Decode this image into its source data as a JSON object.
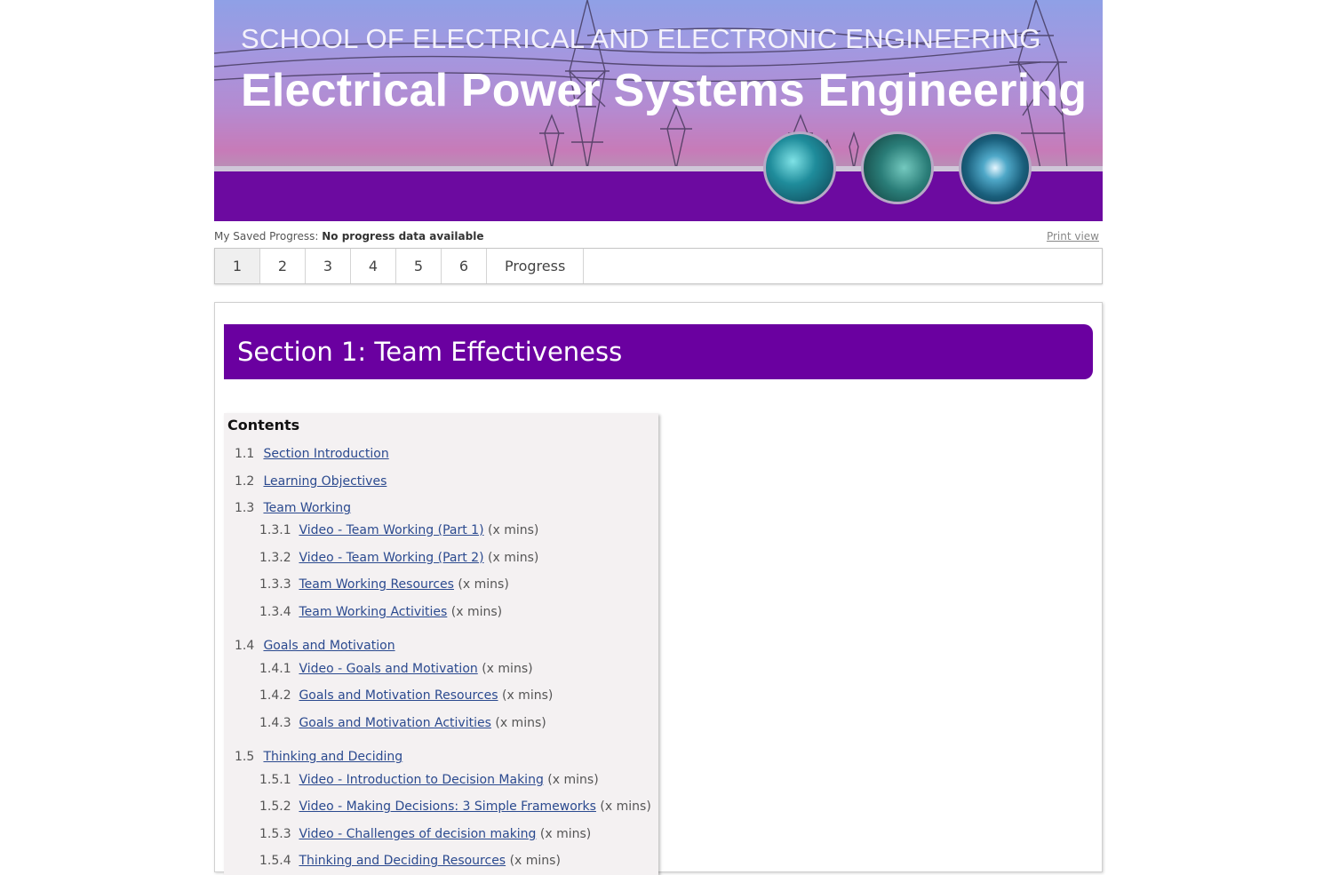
{
  "banner": {
    "school": "SCHOOL OF ELECTRICAL AND ELECTRONIC ENGINEERING",
    "title": "Electrical Power Systems Engineering"
  },
  "progress": {
    "label": "My Saved Progress:",
    "value": "No progress data available",
    "print_view": "Print view"
  },
  "tabs": [
    "1",
    "2",
    "3",
    "4",
    "5",
    "6",
    "Progress"
  ],
  "section": {
    "heading": "Section 1: Team Effectiveness"
  },
  "toc": {
    "title": "Contents",
    "items": [
      {
        "num": "1.1",
        "label": "Section Introduction",
        "dur": ""
      },
      {
        "num": "1.2",
        "label": "Learning Objectives",
        "dur": ""
      },
      {
        "num": "1.3",
        "label": "Team Working",
        "dur": ""
      },
      {
        "num": "1.3.1",
        "label": "Video - Team Working (Part 1)",
        "dur": "(x mins)"
      },
      {
        "num": "1.3.2",
        "label": "Video - Team Working (Part 2)",
        "dur": "(x mins)"
      },
      {
        "num": "1.3.3",
        "label": "Team Working Resources",
        "dur": "(x mins)"
      },
      {
        "num": "1.3.4",
        "label": "Team Working Activities",
        "dur": "(x mins)"
      },
      {
        "num": "1.4",
        "label": "Goals and Motivation",
        "dur": ""
      },
      {
        "num": "1.4.1",
        "label": "Video - Goals and Motivation",
        "dur": "(x mins)"
      },
      {
        "num": "1.4.2",
        "label": "Goals and Motivation Resources",
        "dur": "(x mins)"
      },
      {
        "num": "1.4.3",
        "label": "Goals and Motivation Activities",
        "dur": "(x mins)"
      },
      {
        "num": "1.5",
        "label": "Thinking and Deciding",
        "dur": ""
      },
      {
        "num": "1.5.1",
        "label": "Video - Introduction to Decision Making",
        "dur": "(x mins)"
      },
      {
        "num": "1.5.2",
        "label": "Video - Making Decisions: 3 Simple Frameworks",
        "dur": "(x mins)"
      },
      {
        "num": "1.5.3",
        "label": "Video - Challenges of decision making",
        "dur": "(x mins)"
      },
      {
        "num": "1.5.4",
        "label": "Thinking and Deciding Resources",
        "dur": "(x mins)"
      }
    ]
  }
}
